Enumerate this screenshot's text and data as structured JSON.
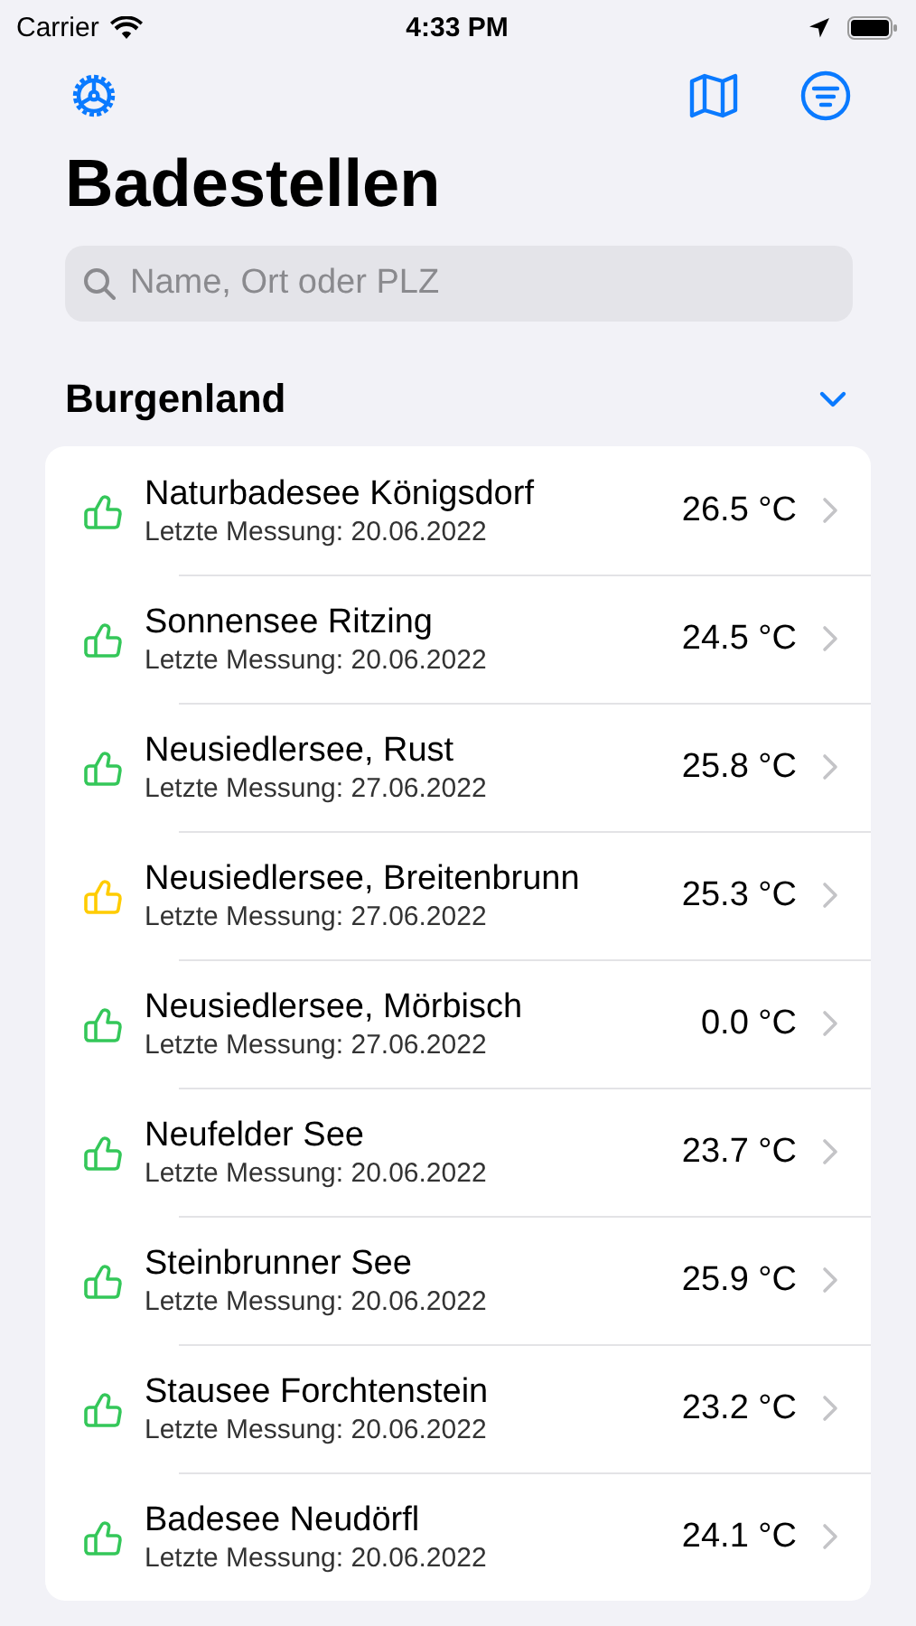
{
  "status_bar": {
    "carrier": "Carrier",
    "time": "4:33 PM"
  },
  "title": "Badestellen",
  "search": {
    "placeholder": "Name, Ort oder PLZ"
  },
  "section": {
    "title": "Burgenland",
    "expanded": true
  },
  "rows": [
    {
      "name": "Naturbadesee Königsdorf",
      "subtitle": "Letzte Messung: 20.06.2022",
      "temperature": "26.5 °C",
      "color": "#34c759"
    },
    {
      "name": "Sonnensee Ritzing",
      "subtitle": "Letzte Messung: 20.06.2022",
      "temperature": "24.5 °C",
      "color": "#34c759"
    },
    {
      "name": "Neusiedlersee, Rust",
      "subtitle": "Letzte Messung: 27.06.2022",
      "temperature": "25.8 °C",
      "color": "#34c759"
    },
    {
      "name": "Neusiedlersee, Breitenbrunn",
      "subtitle": "Letzte Messung: 27.06.2022",
      "temperature": "25.3 °C",
      "color": "#ffcc00"
    },
    {
      "name": "Neusiedlersee, Mörbisch",
      "subtitle": "Letzte Messung: 27.06.2022",
      "temperature": "0.0 °C",
      "color": "#34c759"
    },
    {
      "name": "Neufelder See",
      "subtitle": "Letzte Messung: 20.06.2022",
      "temperature": "23.7 °C",
      "color": "#34c759"
    },
    {
      "name": "Steinbrunner See",
      "subtitle": "Letzte Messung: 20.06.2022",
      "temperature": "25.9 °C",
      "color": "#34c759"
    },
    {
      "name": "Stausee Forchtenstein",
      "subtitle": "Letzte Messung: 20.06.2022",
      "temperature": "23.2 °C",
      "color": "#34c759"
    },
    {
      "name": "Badesee Neudörfl",
      "subtitle": "Letzte Messung: 20.06.2022",
      "temperature": "24.1 °C",
      "color": "#34c759"
    }
  ]
}
